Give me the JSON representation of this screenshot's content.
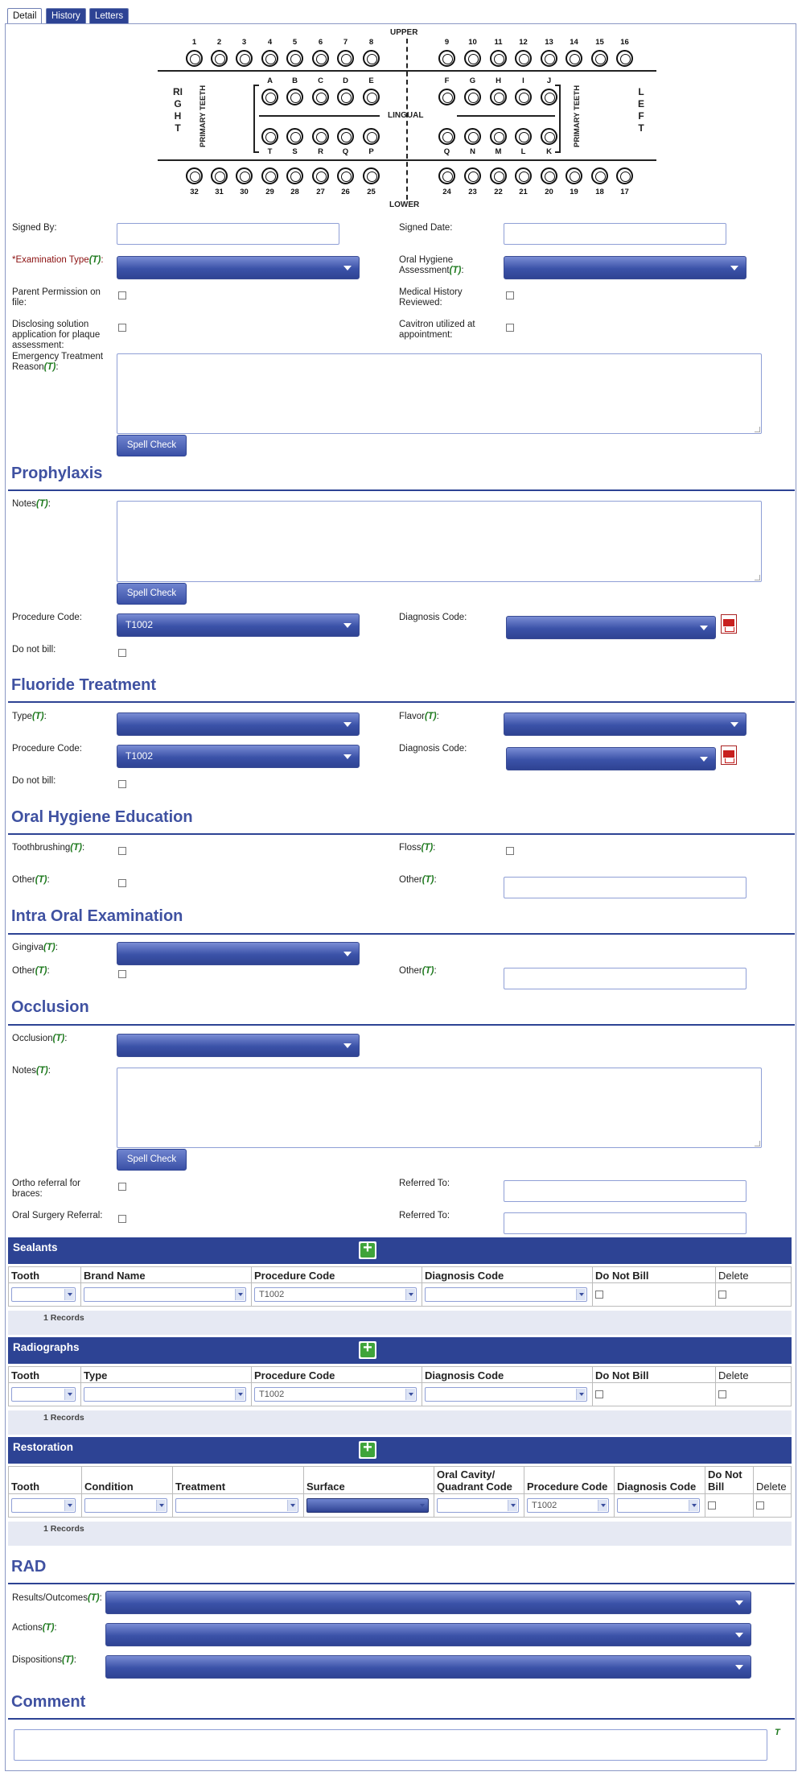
{
  "tabs": [
    {
      "label": "Detail"
    },
    {
      "label": "History"
    },
    {
      "label": "Letters"
    }
  ],
  "chart": {
    "upper": "UPPER",
    "lower": "LOWER",
    "lingual": "LINGUAL",
    "right": "RIGHT",
    "left": "LEFT",
    "primary": "PRIMARY TEETH",
    "upper_nums": [
      "1",
      "2",
      "3",
      "4",
      "5",
      "6",
      "7",
      "8",
      "9",
      "10",
      "11",
      "12",
      "13",
      "14",
      "15",
      "16"
    ],
    "primary_upper": [
      "A",
      "B",
      "C",
      "D",
      "E",
      "F",
      "G",
      "H",
      "I",
      "J"
    ],
    "primary_lower": [
      "T",
      "S",
      "R",
      "Q",
      "P",
      "Q",
      "N",
      "M",
      "L",
      "K"
    ],
    "lower_nums": [
      "32",
      "31",
      "30",
      "29",
      "28",
      "27",
      "26",
      "25",
      "24",
      "23",
      "22",
      "21",
      "20",
      "19",
      "18",
      "17"
    ]
  },
  "form": {
    "signed_by": "Signed By:",
    "signed_date": "Signed Date:",
    "exam_type": "Examination Type",
    "exam_req": "*",
    "oral_hygiene": "Oral Hygiene Assessment",
    "parent_perm": "Parent Permission on file:",
    "medical_hist": "Medical History Reviewed:",
    "disclosing": "Disclosing solution application for plaque assessment:",
    "cavitron": "Cavitron utilized at appointment:",
    "emergency": "Emergency Treatment Reason",
    "t": "(T)",
    "colon": ":",
    "spell": "Spell Check"
  },
  "prophylaxis": {
    "title": "Prophylaxis",
    "notes": "Notes",
    "proc": "Procedure Code:",
    "proc_val": "T1002",
    "diag": "Diagnosis Code:",
    "dnb": "Do not bill:"
  },
  "fluoride": {
    "title": "Fluoride Treatment",
    "type": "Type",
    "flavor": "Flavor",
    "proc": "Procedure Code:",
    "proc_val": "T1002",
    "diag": "Diagnosis Code:",
    "dnb": "Do not bill:"
  },
  "ohe": {
    "title": "Oral Hygiene Education",
    "toothbrushing": "Toothbrushing",
    "floss": "Floss",
    "other": "Other"
  },
  "intra": {
    "title": "Intra Oral Examination",
    "gingiva": "Gingiva",
    "other": "Other"
  },
  "occlusion": {
    "title": "Occlusion",
    "occlusion": "Occlusion",
    "notes": "Notes",
    "ortho": "Ortho referral for braces:",
    "referred": "Referred To:",
    "surgery": "Oral Surgery Referral:"
  },
  "sealants": {
    "title": "Sealants",
    "cols": [
      "Tooth",
      "Brand Name",
      "Procedure Code",
      "Diagnosis Code",
      "Do Not Bill",
      "Delete"
    ],
    "proc_val": "T1002",
    "records": "1 Records"
  },
  "radiographs": {
    "title": "Radiographs",
    "cols": [
      "Tooth",
      "Type",
      "Procedure Code",
      "Diagnosis Code",
      "Do Not Bill",
      "Delete"
    ],
    "proc_val": "T1002",
    "records": "1 Records"
  },
  "restoration": {
    "title": "Restoration",
    "cols": [
      "Tooth",
      "Condition",
      "Treatment",
      "Surface",
      "Oral Cavity/ Quadrant Code",
      "Procedure Code",
      "Diagnosis Code",
      "Do Not Bill",
      "Delete"
    ],
    "proc_val": "T1002",
    "records": "1 Records"
  },
  "rad": {
    "title": "RAD",
    "results": "Results/Outcomes",
    "actions": "Actions",
    "dispositions": "Dispositions"
  },
  "comment": {
    "title": "Comment",
    "t": "T"
  }
}
